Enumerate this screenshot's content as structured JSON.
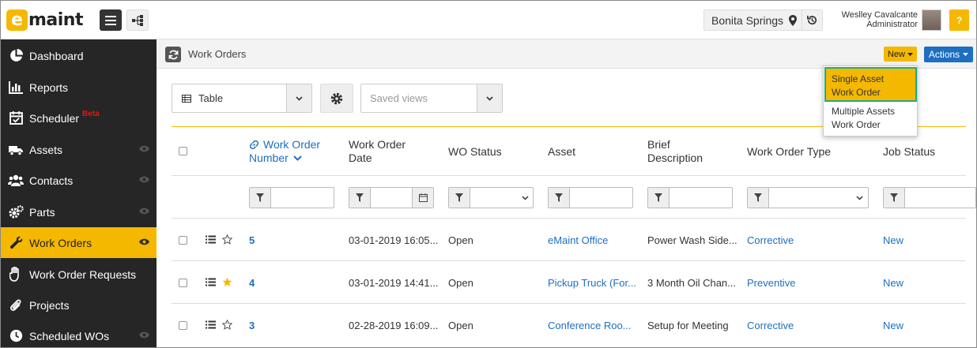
{
  "brand": {
    "logo_letter": "e",
    "logo_text": "maint",
    "accent": "#f5b800"
  },
  "header": {
    "location": "Bonita Springs",
    "user_name": "Weslley Cavalcante",
    "user_role": "Administrator",
    "help_label": "?"
  },
  "sidebar": {
    "items": [
      {
        "label": "Dashboard",
        "icon": "pie-chart-icon"
      },
      {
        "label": "Reports",
        "icon": "bar-chart-icon"
      },
      {
        "label": "Scheduler",
        "icon": "calendar-icon",
        "badge": "Beta"
      },
      {
        "label": "Assets",
        "icon": "truck-icon"
      },
      {
        "label": "Contacts",
        "icon": "users-icon"
      },
      {
        "label": "Parts",
        "icon": "gears-icon"
      },
      {
        "label": "Work Orders",
        "icon": "wrench-icon",
        "active": true
      },
      {
        "label": "Work Order Requests",
        "icon": "hand-icon"
      },
      {
        "label": "Projects",
        "icon": "paperclip-icon"
      },
      {
        "label": "Scheduled WOs",
        "icon": "clock-icon"
      }
    ]
  },
  "page": {
    "title": "Work Orders",
    "new_label": "New",
    "actions_label": "Actions",
    "new_menu": [
      {
        "label1": "Single Asset",
        "label2": "Work Order"
      },
      {
        "label1": "Multiple Assets",
        "label2": "Work Order"
      }
    ],
    "view_label": "Table",
    "saved_views_placeholder": "Saved views"
  },
  "table": {
    "columns": [
      {
        "line1": "Work Order",
        "line2": "Number"
      },
      {
        "line1": "Work Order",
        "line2": "Date"
      },
      {
        "line1": "WO Status",
        "line2": ""
      },
      {
        "line1": "Asset",
        "line2": ""
      },
      {
        "line1": "Brief",
        "line2": "Description"
      },
      {
        "line1": "Work Order Type",
        "line2": ""
      },
      {
        "line1": "Job Status",
        "line2": ""
      }
    ],
    "rows": [
      {
        "number": "5",
        "date": "03-01-2019 16:05...",
        "status": "Open",
        "asset": "eMaint Office",
        "description": "Power Wash Side...",
        "type": "Corrective",
        "job_status": "New",
        "starred": false
      },
      {
        "number": "4",
        "date": "03-01-2019 14:41...",
        "status": "Open",
        "asset": "Pickup Truck (For...",
        "description": "3 Month Oil Chan...",
        "type": "Preventive",
        "job_status": "New",
        "starred": true
      },
      {
        "number": "3",
        "date": "02-28-2019 16:09...",
        "status": "Open",
        "asset": "Conference Roo...",
        "description": "Setup for Meeting",
        "type": "Corrective",
        "job_status": "New",
        "starred": false
      }
    ]
  }
}
